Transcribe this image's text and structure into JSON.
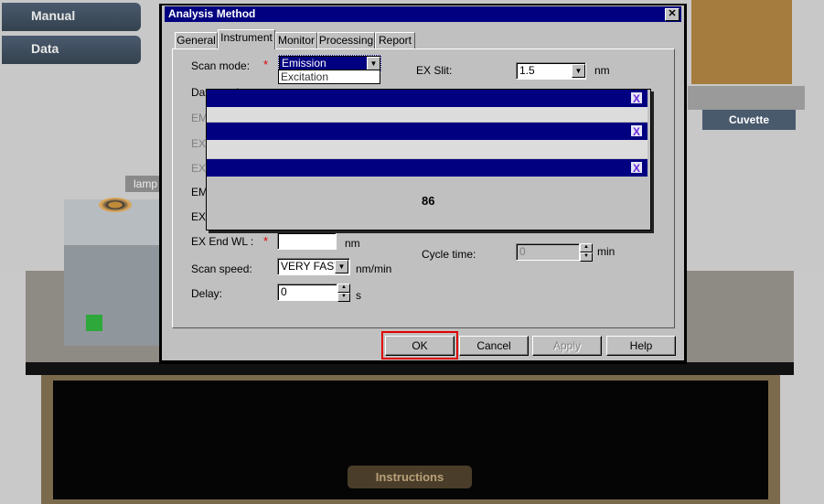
{
  "sidebar": {
    "manual_label": "Manual",
    "data_label": "Data"
  },
  "scene": {
    "cuvette_label": "Cuvette",
    "lamp_label": "lamp",
    "instructions_label": "Instructions"
  },
  "dialog": {
    "title": "Analysis Method",
    "tabs": [
      "General",
      "Instrument",
      "Monitor",
      "Processing",
      "Report"
    ],
    "active_tab": "Instrument",
    "fields": {
      "scan_mode": {
        "label": "Scan mode:",
        "value": "Emission",
        "required": true,
        "open_option": "Excitation"
      },
      "data_mode": {
        "label": "Data mode:"
      },
      "em_wl": {
        "label": "EM WL:"
      },
      "ex_start": {
        "label": "EX Start WL:"
      },
      "ex_wl": {
        "label": "EX WL:"
      },
      "em_start": {
        "label": "EM Start WL:"
      },
      "ex_end_partial": {
        "label": "EX"
      },
      "ex_end_wl": {
        "label": "EX End WL :",
        "value": "",
        "unit": "nm",
        "required": true
      },
      "scan_speed": {
        "label": "Scan speed:",
        "value": "VERY FAST",
        "unit": "nm/min"
      },
      "delay": {
        "label": "Delay:",
        "value": "0",
        "unit": "s"
      },
      "ex_slit": {
        "label": "EX Slit:",
        "value": "1.5",
        "unit": "nm"
      },
      "cycle_time": {
        "label": "Cycle time:",
        "value": "0",
        "unit": "min"
      }
    },
    "required_marker": "*",
    "buttons": {
      "ok": "OK",
      "cancel": "Cancel",
      "apply": "Apply",
      "help": "Help"
    },
    "close_glyph": "✕"
  },
  "progress_windows": {
    "close_label": "X",
    "status_text": "86"
  }
}
